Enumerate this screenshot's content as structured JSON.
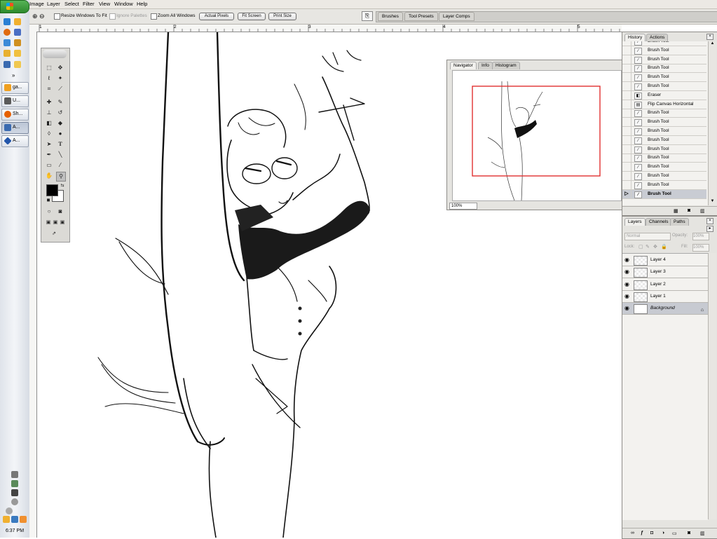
{
  "taskbar": {
    "start_label": "start",
    "quick_launch": [
      "ie-icon",
      "firefox-icon",
      "msn-icon",
      "outlook-icon",
      "desktop-icon",
      "folder-icon",
      "winamp-icon",
      "photoshop-icon",
      "media-icon"
    ],
    "tasks": [
      {
        "label": "ga...",
        "icon": "gallery-icon",
        "color": "#f0a020"
      },
      {
        "label": "U...",
        "icon": "window-icon",
        "color": "#5a5a5a"
      },
      {
        "label": "Sh...",
        "icon": "firefox-icon",
        "color": "#e66000"
      },
      {
        "label": "A...",
        "icon": "photoshop-icon",
        "color": "#3a6ab0"
      },
      {
        "label": "A...",
        "icon": "app-icon",
        "color": "#2255aa"
      }
    ],
    "clock": "6:37 PM"
  },
  "menu": [
    "Image",
    "Layer",
    "Select",
    "Filter",
    "View",
    "Window",
    "Help"
  ],
  "options_bar": {
    "resize_windows": "Resize Windows To Fit",
    "ignore_palettes": "Ignore Palettes",
    "zoom_all": "Zoom All Windows",
    "actual_pixels": "Actual Pixels",
    "fit_screen": "Fit Screen",
    "print_size": "Print Size",
    "well_tabs": [
      "Brushes",
      "Tool Presets",
      "Layer Comps"
    ]
  },
  "ruler": {
    "labels": [
      "1",
      "2",
      "3",
      "4",
      "5"
    ]
  },
  "navigator": {
    "tabs": [
      "Navigator",
      "Info",
      "Histogram"
    ],
    "zoom": "100%",
    "view_box_color": "#e03030"
  },
  "history": {
    "tabs": [
      "History",
      "Actions"
    ],
    "items": [
      {
        "label": "Brush Tool",
        "icon": "brush-icon"
      },
      {
        "label": "Brush Tool",
        "icon": "brush-icon"
      },
      {
        "label": "Brush Tool",
        "icon": "brush-icon"
      },
      {
        "label": "Brush Tool",
        "icon": "brush-icon"
      },
      {
        "label": "Brush Tool",
        "icon": "brush-icon"
      },
      {
        "label": "Brush Tool",
        "icon": "brush-icon"
      },
      {
        "label": "Eraser",
        "icon": "eraser-icon"
      },
      {
        "label": "Flip Canvas Horizontal",
        "icon": "canvas-icon"
      },
      {
        "label": "Brush Tool",
        "icon": "brush-icon"
      },
      {
        "label": "Brush Tool",
        "icon": "brush-icon"
      },
      {
        "label": "Brush Tool",
        "icon": "brush-icon"
      },
      {
        "label": "Brush Tool",
        "icon": "brush-icon"
      },
      {
        "label": "Brush Tool",
        "icon": "brush-icon"
      },
      {
        "label": "Brush Tool",
        "icon": "brush-icon"
      },
      {
        "label": "Brush Tool",
        "icon": "brush-icon"
      },
      {
        "label": "Brush Tool",
        "icon": "brush-icon"
      },
      {
        "label": "Brush Tool",
        "icon": "brush-icon"
      },
      {
        "label": "Brush Tool",
        "icon": "brush-icon",
        "selected": true
      }
    ]
  },
  "layers": {
    "tabs": [
      "Layers",
      "Channels",
      "Paths"
    ],
    "blend_mode": "Normal",
    "opacity_label": "Opacity:",
    "opacity_value": "100%",
    "lock_label": "Lock:",
    "fill_label": "Fill:",
    "fill_value": "100%",
    "items": [
      {
        "name": "Layer 4"
      },
      {
        "name": "Layer 3"
      },
      {
        "name": "Layer 2"
      },
      {
        "name": "Layer 1"
      },
      {
        "name": "Background",
        "selected": true,
        "locked": true
      }
    ]
  }
}
